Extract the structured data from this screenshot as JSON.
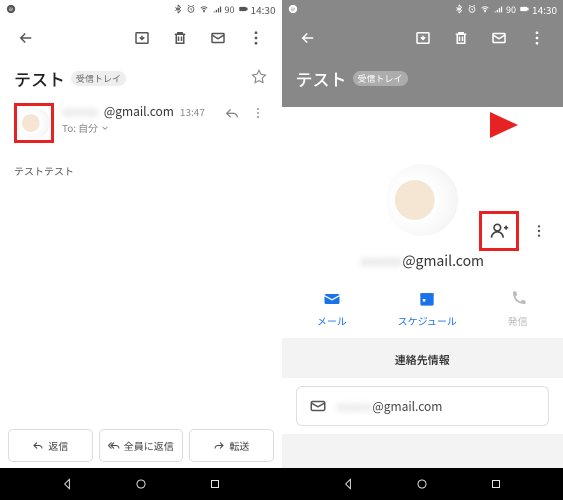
{
  "status": {
    "time": "14:30",
    "battery": "90"
  },
  "left": {
    "subject": "テスト",
    "label": "受信トレイ",
    "sender_name": "xxxxxx",
    "sender_email": "@gmail.com",
    "time": "13:47",
    "to_prefix": "To:",
    "to_value": "自分",
    "body": "テストテスト",
    "reply": "返信",
    "reply_all": "全員に返信",
    "forward": "転送"
  },
  "right": {
    "subject": "テスト",
    "label": "受信トレイ",
    "email_name": "xxxxxx",
    "email_domain": "@gmail.com",
    "actions": {
      "mail": "メール",
      "schedule": "スケジュール",
      "call": "発信"
    },
    "section_title": "連絡先情報",
    "info_email_name": "xxxxxx",
    "info_email_domain": "@gmail.com"
  }
}
